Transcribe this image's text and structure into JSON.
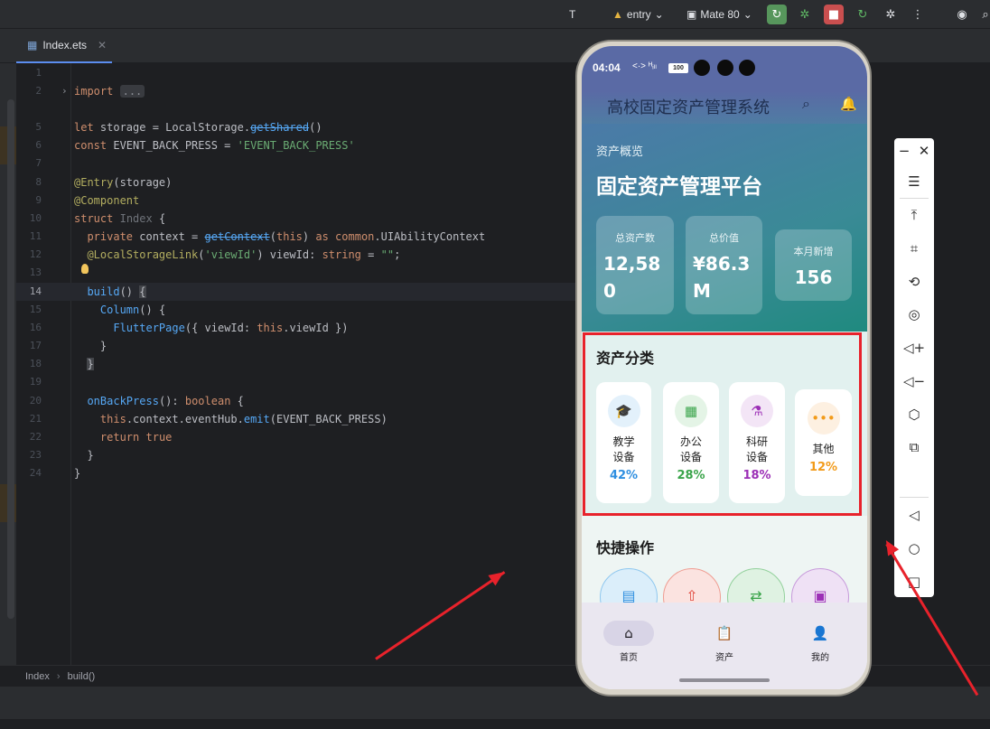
{
  "toolbar": {
    "entry_label": "entry",
    "device_label": "Mate 80"
  },
  "tabs": [
    {
      "label": "Index.ets"
    }
  ],
  "editor": {
    "lines": [
      {
        "n": "1"
      },
      {
        "n": "2"
      },
      {
        "n": "5"
      },
      {
        "n": "6"
      },
      {
        "n": "7"
      },
      {
        "n": "8"
      },
      {
        "n": "9"
      },
      {
        "n": "10"
      },
      {
        "n": "11"
      },
      {
        "n": "12"
      },
      {
        "n": "13"
      },
      {
        "n": "14"
      },
      {
        "n": "15"
      },
      {
        "n": "16"
      },
      {
        "n": "17"
      },
      {
        "n": "18"
      },
      {
        "n": "19"
      },
      {
        "n": "20"
      },
      {
        "n": "21"
      },
      {
        "n": "22"
      },
      {
        "n": "23"
      },
      {
        "n": "24"
      }
    ]
  },
  "breadcrumb": {
    "file": "Index",
    "member": "build()"
  },
  "phone": {
    "status_time": "04:04",
    "status_icons": "<·> ᴴᵢₗₗ",
    "battery": "100",
    "app_title": "高校固定资产管理系统",
    "hero_subtitle": "资产概览",
    "hero_title": "固定资产管理平台",
    "stats": [
      {
        "label": "总资产数",
        "value": "12,58\n0"
      },
      {
        "label": "总价值",
        "value": "¥86.3\nM"
      },
      {
        "label": "本月新增",
        "value": "156"
      }
    ],
    "category_title": "资产分类",
    "categories": [
      {
        "name": "教学\n设备",
        "pct": "42%",
        "icon": "graduation-cap-icon",
        "color": "#2f8fe0",
        "bg": "#e3f1fb"
      },
      {
        "name": "办公\n设备",
        "pct": "28%",
        "icon": "building-icon",
        "color": "#3aa44a",
        "bg": "#e4f4e6"
      },
      {
        "name": "科研\n设备",
        "pct": "18%",
        "icon": "flask-icon",
        "color": "#9c2fb6",
        "bg": "#f3e5f6"
      },
      {
        "name": "其他",
        "pct": "12%",
        "icon": "more-icon",
        "color": "#f29b1a",
        "bg": "#fdf0e1"
      }
    ],
    "quick_title": "快捷操作",
    "nav": [
      {
        "label": "首页",
        "icon": "home-icon"
      },
      {
        "label": "资产",
        "icon": "clipboard-icon"
      },
      {
        "label": "我的",
        "icon": "person-icon"
      }
    ]
  }
}
